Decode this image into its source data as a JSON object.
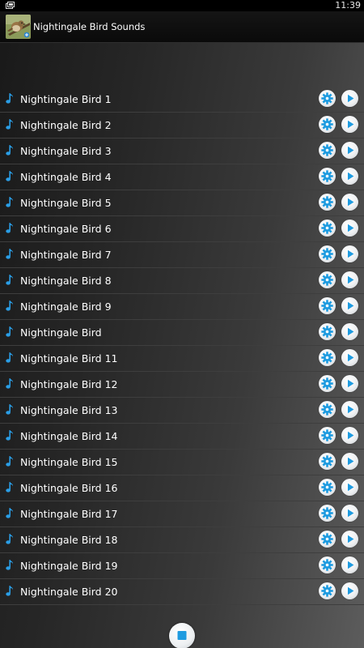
{
  "status_bar": {
    "time": "11:39",
    "icons": [
      "notification-icon"
    ]
  },
  "action_bar": {
    "title": "Nightingale Bird Sounds",
    "icon": "nightingale-bird-icon"
  },
  "sounds": [
    {
      "label": "Nightingale Bird 1"
    },
    {
      "label": "Nightingale Bird 2"
    },
    {
      "label": "Nightingale Bird 3"
    },
    {
      "label": "Nightingale Bird 4"
    },
    {
      "label": "Nightingale Bird 5"
    },
    {
      "label": "Nightingale Bird 6"
    },
    {
      "label": "Nightingale Bird 7"
    },
    {
      "label": "Nightingale Bird 8"
    },
    {
      "label": "Nightingale Bird 9"
    },
    {
      "label": "Nightingale Bird"
    },
    {
      "label": "Nightingale Bird 11"
    },
    {
      "label": "Nightingale Bird 12"
    },
    {
      "label": "Nightingale Bird 13"
    },
    {
      "label": "Nightingale Bird 14"
    },
    {
      "label": "Nightingale Bird 15"
    },
    {
      "label": "Nightingale Bird 16"
    },
    {
      "label": "Nightingale Bird 17"
    },
    {
      "label": "Nightingale Bird 18"
    },
    {
      "label": "Nightingale Bird 19"
    },
    {
      "label": "Nightingale Bird 20"
    }
  ],
  "row_icons": {
    "leading": "music-note-icon",
    "settings": "gear-icon",
    "play": "play-icon"
  },
  "bottom": {
    "stop_icon": "stop-icon"
  },
  "colors": {
    "accent_blue": "#1e9be0",
    "note_blue": "#2a9ee6",
    "status_bar": "#000000",
    "action_bar": "#111111"
  }
}
